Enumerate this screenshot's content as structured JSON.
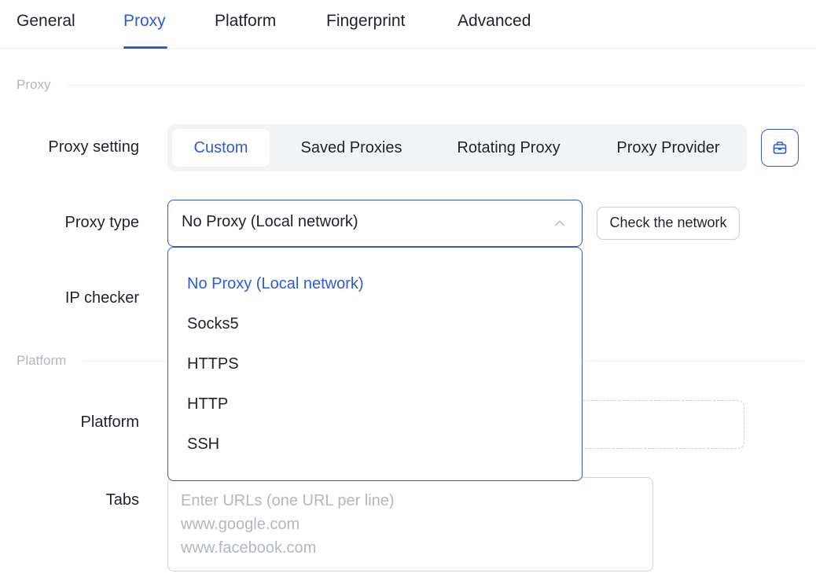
{
  "tabs": {
    "items": [
      {
        "label": "General"
      },
      {
        "label": "Proxy"
      },
      {
        "label": "Platform"
      },
      {
        "label": "Fingerprint"
      },
      {
        "label": "Advanced"
      }
    ],
    "active": "Proxy"
  },
  "sections": {
    "proxy": "Proxy",
    "platform": "Platform"
  },
  "form": {
    "proxy_setting_label": "Proxy setting",
    "proxy_type_label": "Proxy type",
    "ip_checker_label": "IP checker",
    "platform_label": "Platform",
    "tabs_label": "Tabs"
  },
  "proxy_setting": {
    "options": [
      "Custom",
      "Saved Proxies",
      "Rotating Proxy",
      "Proxy Provider"
    ],
    "selected": "Custom",
    "icon": "shopping-bag-icon"
  },
  "proxy_type": {
    "value": "No Proxy (Local network)",
    "options": [
      "No Proxy (Local network)",
      "Socks5",
      "HTTPS",
      "HTTP",
      "SSH"
    ],
    "selected": "No Proxy (Local network)"
  },
  "check_network_label": "Check the network",
  "tabs_input": {
    "placeholder": "Enter URLs (one URL per line)\nwww.google.com\nwww.facebook.com"
  },
  "colors": {
    "accent": "#2f5ad8",
    "text": "#1f2329",
    "muted": "#b3b7bf",
    "segment_bg": "#f2f3f5"
  }
}
